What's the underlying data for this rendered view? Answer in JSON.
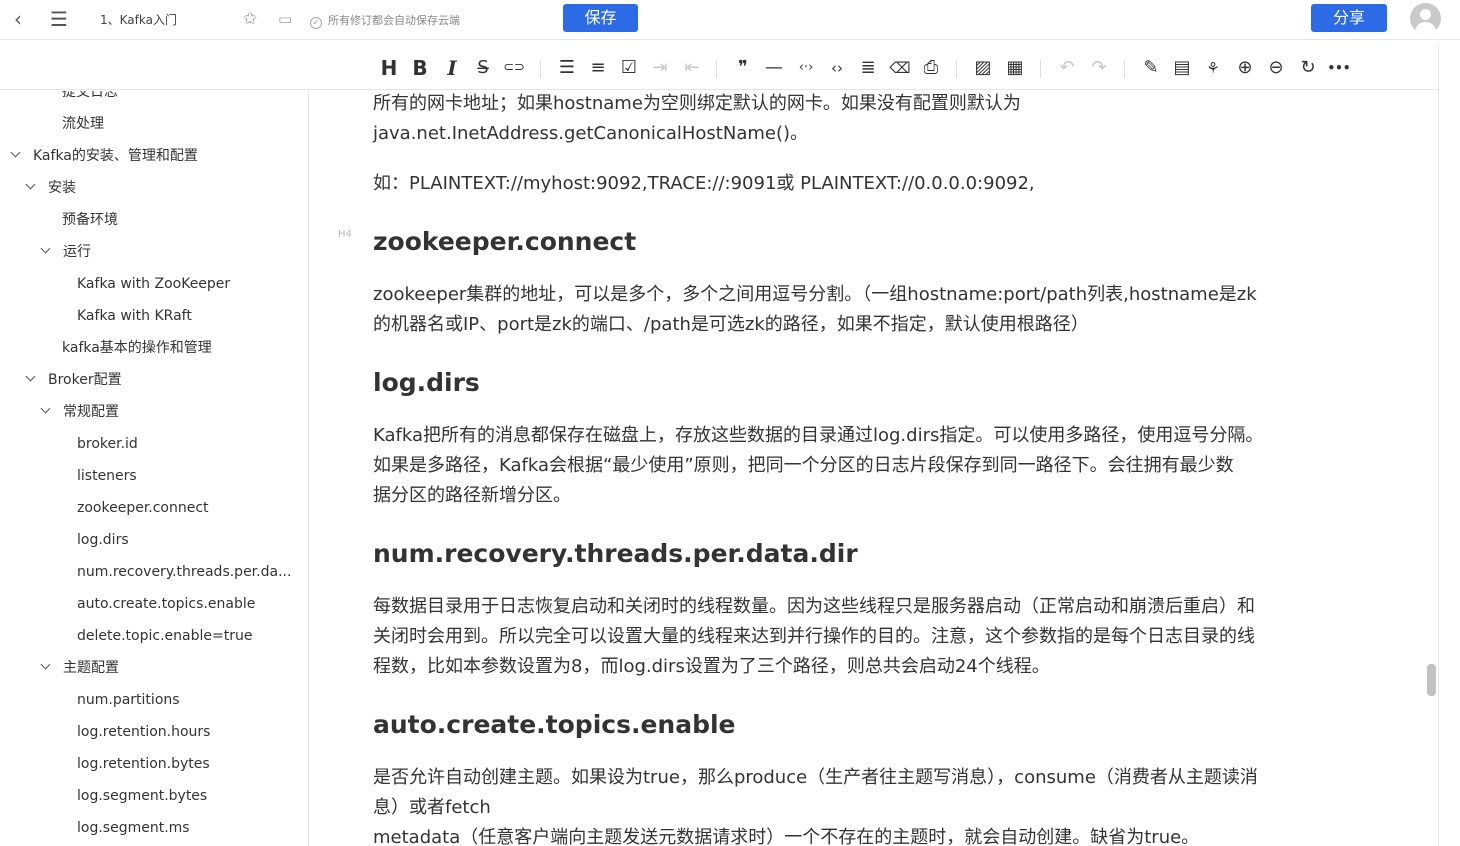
{
  "topbar": {
    "back_icon": "‹",
    "menu_icon": "☰",
    "doc_title": "1、Kafka入门",
    "save_status": "所有修订都会自动保存云端",
    "save_label": "保存",
    "share_label": "分享",
    "accent_color": "#2d6be6"
  },
  "toolbar": {
    "icons": [
      "heading-icon",
      "bold-icon",
      "italic-icon",
      "strikethrough-icon",
      "link-icon",
      "bullet-list-icon",
      "ordered-list-icon",
      "checklist-icon",
      "indent-icon",
      "outdent-icon",
      "quote-icon",
      "horizontal-rule-icon",
      "inline-code-icon",
      "code-block-icon",
      "table-of-contents-icon",
      "clear-format-icon",
      "export-icon",
      "image-icon",
      "table-icon",
      "undo-icon",
      "redo-icon",
      "edit-icon",
      "note-icon",
      "mindmap-icon",
      "zoom-in-icon",
      "zoom-out-icon",
      "refresh-icon",
      "more-icon"
    ],
    "glyphs": {
      "heading": "H",
      "bold": "B",
      "italic": "I",
      "strike": "S̶",
      "link": "⊂⊃",
      "ul": "☰",
      "ol": "≡",
      "check": "☑",
      "indent": "⇥",
      "outdent": "⇤",
      "quote": "❞",
      "hr": "—",
      "inline_code": "‹·›",
      "code_block": "‹›",
      "toc": "≣",
      "clear": "⌫",
      "export": "⎙",
      "image": "▨",
      "table": "▦",
      "undo": "↶",
      "redo": "↷",
      "edit": "✎",
      "note": "▤",
      "mindmap": "⚘",
      "zoom_in": "⊕",
      "zoom_out": "⊖",
      "refresh": "↻",
      "more": "•••"
    }
  },
  "sidebar": {
    "items": [
      {
        "label": "提交日志",
        "expanded": null
      },
      {
        "label": "流处理",
        "expanded": null
      },
      {
        "label": "Kafka的安装、管理和配置",
        "expanded": true
      },
      {
        "label": "安装",
        "expanded": true
      },
      {
        "label": "预备环境",
        "expanded": null
      },
      {
        "label": "运行",
        "expanded": true
      },
      {
        "label": "Kafka with ZooKeeper",
        "expanded": null
      },
      {
        "label": "Kafka with KRaft",
        "expanded": null
      },
      {
        "label": "kafka基本的操作和管理",
        "expanded": null
      },
      {
        "label": "Broker配置",
        "expanded": true
      },
      {
        "label": "常规配置",
        "expanded": true
      },
      {
        "label": "broker.id",
        "expanded": null
      },
      {
        "label": "listeners",
        "expanded": null
      },
      {
        "label": "zookeeper.connect",
        "expanded": null
      },
      {
        "label": "log.dirs",
        "expanded": null
      },
      {
        "label": "num.recovery.threads.per.da...",
        "expanded": null
      },
      {
        "label": "auto.create.topics.enable",
        "expanded": null
      },
      {
        "label": "delete.topic.enable=true",
        "expanded": null
      },
      {
        "label": "主题配置",
        "expanded": true
      },
      {
        "label": "num.partitions",
        "expanded": null
      },
      {
        "label": "log.retention.hours",
        "expanded": null
      },
      {
        "label": "log.retention.bytes",
        "expanded": null
      },
      {
        "label": "log.segment.bytes",
        "expanded": null
      },
      {
        "label": "log.segment.ms",
        "expanded": null
      }
    ]
  },
  "content": {
    "listeners_tail_1": "所有的网卡地址；如果hostname为空则绑定默认的网卡。如果没有配置则默认为",
    "listeners_tail_2": "java.net.InetAddress.getCanonicalHostName()。",
    "listeners_example": "如：PLAINTEXT://myhost:9092,TRACE://:9091或 PLAINTEXT://0.0.0.0:9092,",
    "heading_marker": "H4",
    "zk_heading": "zookeeper.connect",
    "zk_text_1": "zookeeper集群的地址，可以是多个，多个之间用逗号分割。（一组hostname:port/path列表,hostname是zk",
    "zk_text_2": "的机器名或IP、port是zk的端口、/path是可选zk的路径，如果不指定，默认使用根路径）",
    "logdirs_heading": "log.dirs",
    "logdirs_text_1": "Kafka把所有的消息都保存在磁盘上，存放这些数据的目录通过log.dirs指定。可以使用多路径，使用逗号分隔。",
    "logdirs_text_2": "如果是多路径，Kafka会根据“最少使用”原则，把同一个分区的日志片段保存到同一路径下。会往拥有最少数",
    "logdirs_text_3": "据分区的路径新增分区。",
    "numrec_heading": "num.recovery.threads.per.data.dir",
    "numrec_text_1": "每数据目录用于日志恢复启动和关闭时的线程数量。因为这些线程只是服务器启动（正常启动和崩溃后重启）和",
    "numrec_text_2": "关闭时会用到。所以完全可以设置大量的线程来达到并行操作的目的。注意，这个参数指的是每个日志目录的线",
    "numrec_text_3": "程数，比如本参数设置为8，而log.dirs设置为了三个路径，则总共会启动24个线程。",
    "autocreate_heading": "auto.create.topics.enable",
    "autocreate_text_1": "是否允许自动创建主题。如果设为true，那么produce（生产者往主题写消息），consume（消费者从主题读消",
    "autocreate_text_2": "息）或者fetch",
    "autocreate_text_3": "metadata（任意客户端向主题发送元数据请求时）一个不存在的主题时，就会自动创建。缺省为true。"
  }
}
